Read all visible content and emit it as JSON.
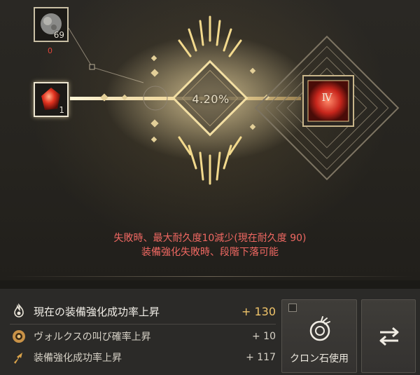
{
  "materials": {
    "gray_stone": {
      "icon": "gray-stone-icon",
      "count": "69",
      "zero_label": "0"
    },
    "red_crystal": {
      "icon": "red-crystal-icon",
      "count": "1"
    }
  },
  "enhance": {
    "success_rate": "4.20%",
    "target_level": "Ⅳ"
  },
  "warnings": {
    "line1": "失敗時、最大耐久度10減少(現在耐久度 90)",
    "line2": "装備強化失敗時、段階下落可能"
  },
  "stats": [
    {
      "icon": "flame-icon",
      "label": "現在の装備強化成功率上昇",
      "value": "+ 130"
    },
    {
      "icon": "volks-cry-icon",
      "label": "ヴォルクスの叫び確率上昇",
      "value": "+ 10"
    },
    {
      "icon": "arrow-up-icon",
      "label": "装備強化成功率上昇",
      "value": "+ 117"
    }
  ],
  "actions": {
    "clone_label": "クロン石使用",
    "clone_icon": "cron-stone-icon",
    "swap_icon": "swap-arrows-icon"
  },
  "colors": {
    "accent_gold": "#f0c46a",
    "warning_red": "#ef6862",
    "count_red": "#e0463a"
  }
}
